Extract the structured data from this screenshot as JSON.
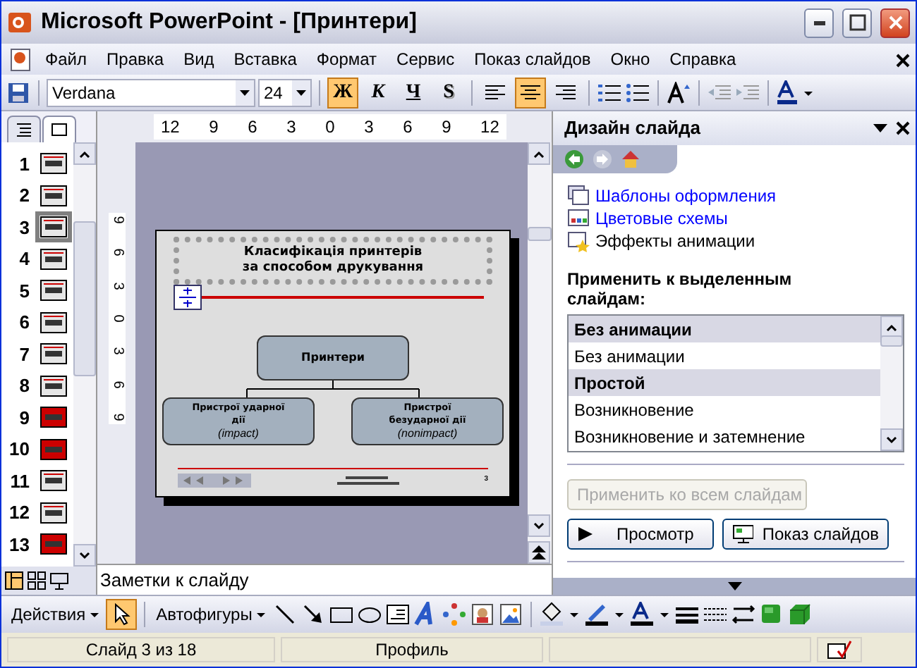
{
  "window": {
    "title": "Microsoft PowerPoint - [Принтери]"
  },
  "menu": [
    "Файл",
    "Правка",
    "Вид",
    "Вставка",
    "Формат",
    "Сервис",
    "Показ слайдов",
    "Окно",
    "Справка"
  ],
  "toolbar": {
    "font": "Verdana",
    "size": "24",
    "format_buttons": [
      {
        "label": "Ж",
        "kind": "bold",
        "selected": true
      },
      {
        "label": "К",
        "kind": "italic",
        "selected": false
      },
      {
        "label": "Ч",
        "kind": "underline",
        "selected": false
      },
      {
        "label": "S",
        "kind": "shadow",
        "selected": false
      }
    ],
    "align_buttons": [
      {
        "kind": "left",
        "selected": false
      },
      {
        "kind": "center",
        "selected": true
      },
      {
        "kind": "right",
        "selected": false
      }
    ]
  },
  "slides": [
    {
      "number": "1",
      "color": "#e6e6e6",
      "selected": false
    },
    {
      "number": "2",
      "color": "#e6e6e6",
      "selected": false
    },
    {
      "number": "3",
      "color": "#e6e6e6",
      "selected": true
    },
    {
      "number": "4",
      "color": "#e6e6e6",
      "selected": false
    },
    {
      "number": "5",
      "color": "#e6e6e6",
      "selected": false
    },
    {
      "number": "6",
      "color": "#e6e6e6",
      "selected": false
    },
    {
      "number": "7",
      "color": "#e6e6e6",
      "selected": false
    },
    {
      "number": "8",
      "color": "#e6e6e6",
      "selected": false
    },
    {
      "number": "9",
      "color": "#cc0000",
      "selected": false
    },
    {
      "number": "10",
      "color": "#cc0000",
      "selected": false
    },
    {
      "number": "11",
      "color": "#e6e6e6",
      "selected": false
    },
    {
      "number": "12",
      "color": "#e6e6e6",
      "selected": false
    },
    {
      "number": "13",
      "color": "#cc0000",
      "selected": false
    }
  ],
  "ruler": {
    "horizontal": [
      "12",
      "9",
      "6",
      "3",
      "0",
      "3",
      "6",
      "9",
      "12"
    ],
    "vertical": [
      "9",
      "6",
      "3",
      "0",
      "3",
      "6",
      "9"
    ]
  },
  "slide": {
    "title_lines": [
      "Класифікація принтерів",
      "за способом друкування"
    ],
    "root": "Принтери",
    "branches": [
      {
        "label": "Пристрої ударної дії",
        "term": "(impact)"
      },
      {
        "label": "Пристрої безударної дії",
        "term": "(nonimpact)"
      }
    ],
    "number": "3"
  },
  "notes": {
    "placeholder": "Заметки к слайду"
  },
  "task_pane": {
    "title": "Дизайн слайда",
    "links": [
      {
        "label": "Шаблоны оформления",
        "kind": "templates",
        "selected": false
      },
      {
        "label": "Цветовые схемы",
        "kind": "colors",
        "selected": false
      },
      {
        "label": "Эффекты анимации",
        "kind": "animation",
        "selected": true
      }
    ],
    "apply_label": "Применить к выделенным слайдам:",
    "effects": [
      {
        "text": "Без анимации",
        "kind": "group"
      },
      {
        "text": "Без анимации",
        "kind": "item"
      },
      {
        "text": "Простой",
        "kind": "group"
      },
      {
        "text": "Возникновение",
        "kind": "item"
      },
      {
        "text": "Возникновение и затемнение",
        "kind": "item"
      }
    ],
    "apply_all": {
      "label": "Применить ко всем слайдам",
      "disabled": true
    },
    "preview": "Просмотр",
    "slideshow": "Показ слайдов"
  },
  "drawing_toolbar": {
    "actions": "Действия",
    "autoshapes": "Автофигуры"
  },
  "status_bar": {
    "slide": "Слайд 3 из 18",
    "design": "Профиль"
  }
}
